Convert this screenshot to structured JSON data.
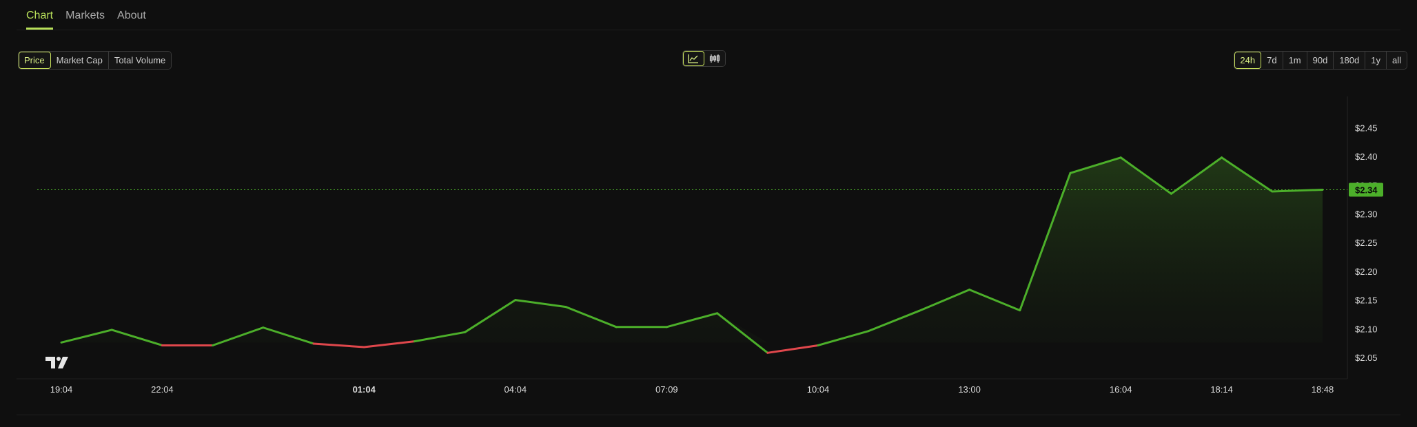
{
  "tabs": [
    "Chart",
    "Markets",
    "About"
  ],
  "active_tab": 0,
  "metric_buttons": [
    "Price",
    "Market Cap",
    "Total Volume"
  ],
  "active_metric": 0,
  "range_buttons": [
    "24h",
    "7d",
    "1m",
    "90d",
    "180d",
    "1y",
    "all"
  ],
  "active_range": 0,
  "chart_type_buttons": [
    {
      "name": "line-chart-icon",
      "active": true
    },
    {
      "name": "candlestick-chart-icon",
      "active": false
    }
  ],
  "logo_text": "TV",
  "colors": {
    "up": "#4caf2a",
    "down": "#e0474c",
    "accent": "#c9e25c"
  },
  "chart_data": {
    "type": "line",
    "x": [
      "19:04",
      "",
      "22:04",
      "",
      "",
      "",
      "01:04",
      "",
      "",
      "04:04",
      "",
      "",
      "07:09",
      "",
      "",
      "10:04",
      "",
      "",
      "13:00",
      "",
      "",
      "16:04",
      "",
      "18:14",
      "",
      "18:48"
    ],
    "x_ticks": [
      "19:04",
      "22:04",
      "01:04",
      "04:04",
      "07:09",
      "10:04",
      "13:00",
      "16:04",
      "18:14",
      "18:48"
    ],
    "values": [
      2.076,
      2.098,
      2.071,
      2.071,
      2.102,
      2.074,
      2.068,
      2.078,
      2.094,
      2.15,
      2.138,
      2.103,
      2.103,
      2.127,
      2.058,
      2.071,
      2.096,
      2.131,
      2.168,
      2.132,
      2.371,
      2.398,
      2.335,
      2.398,
      2.339,
      2.342
    ],
    "last_price_label": "$2.34",
    "yticks": [
      "$2.05",
      "$2.10",
      "$2.15",
      "$2.20",
      "$2.25",
      "$2.30",
      "$2.35",
      "$2.40",
      "$2.45"
    ],
    "ylim": [
      2.02,
      2.48
    ],
    "baseline": 2.076,
    "grid": false
  }
}
